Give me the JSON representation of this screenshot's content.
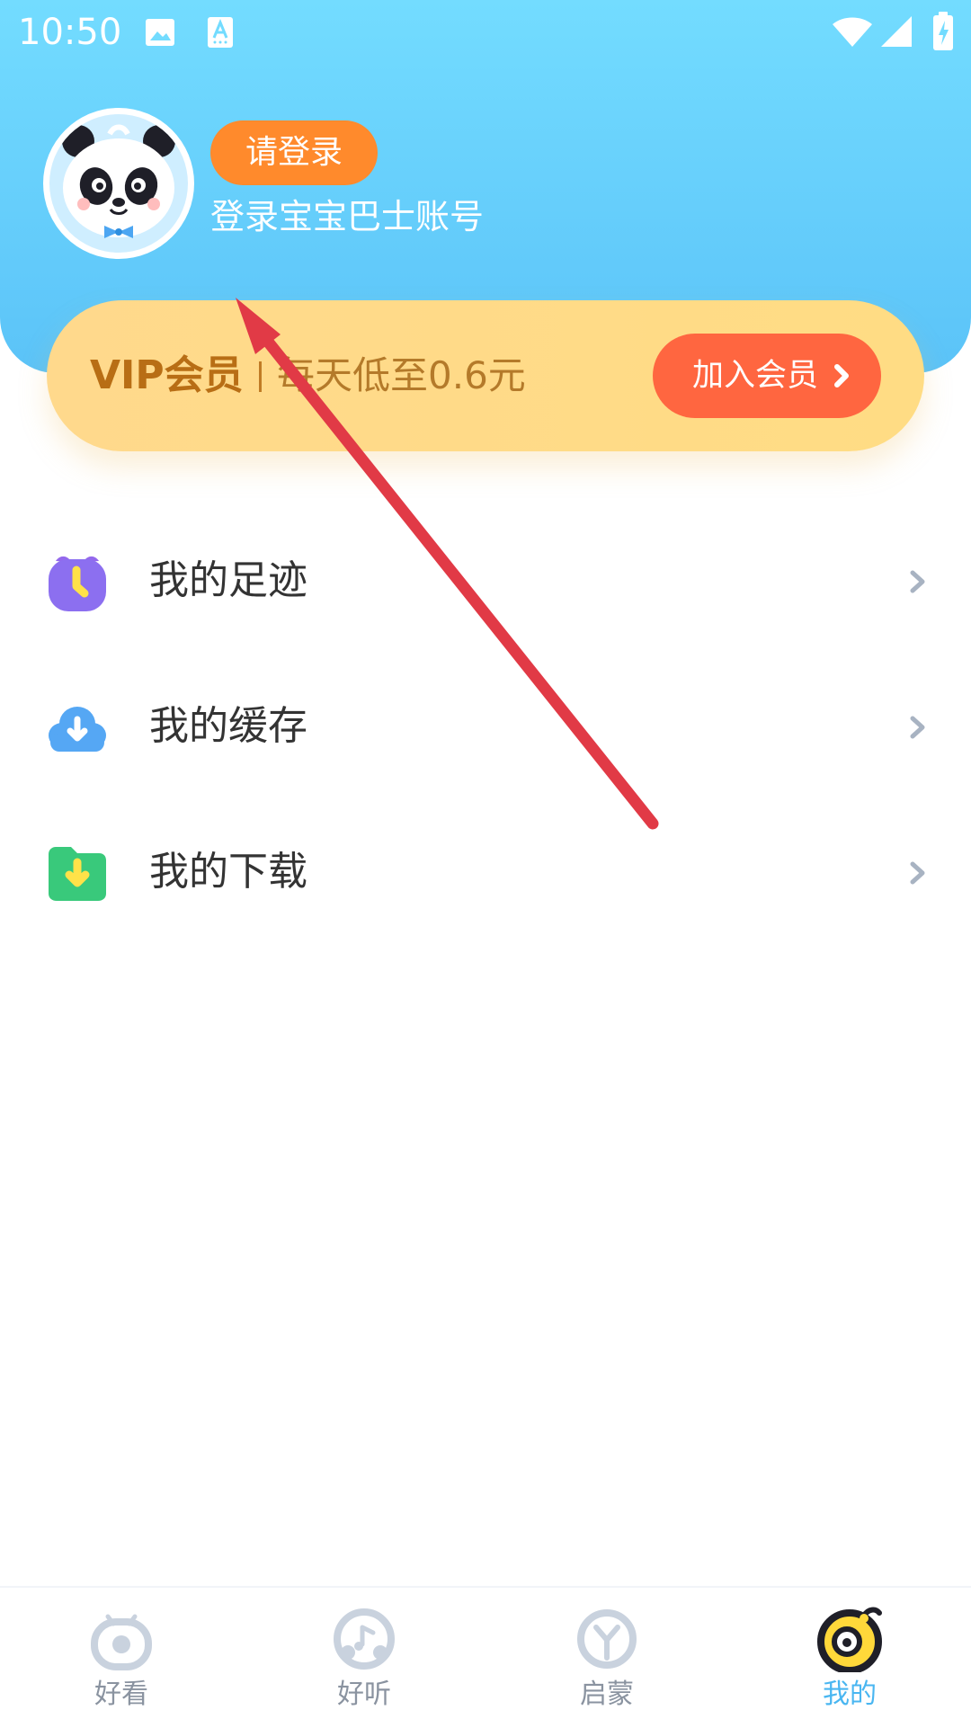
{
  "colors": {
    "header_gradient_start": "#73dcff",
    "header_gradient_end": "#5bc3f8",
    "login_button": "#ff8a2c",
    "vip_card": "#ffdc84",
    "vip_title": "#b86e15",
    "join_button": "#ff6640",
    "nav_active": "#49b6f1",
    "nav_inactive": "#8a93a0",
    "annotation_arrow": "#e13a46"
  },
  "status_bar": {
    "time": "10:50",
    "icons": [
      "image-icon",
      "a-icon",
      "wifi-icon",
      "signal-icon",
      "battery-icon"
    ]
  },
  "profile": {
    "avatar_icon": "panda-avatar",
    "login_button_label": "请登录",
    "subtitle": "登录宝宝巴士账号"
  },
  "vip": {
    "title": "VIP会员",
    "price_text": "每天低至0.6元",
    "join_label": "加入会员",
    "join_icon": "chevron-right-icon"
  },
  "menu": [
    {
      "label": "我的足迹",
      "icon": "clock-icon"
    },
    {
      "label": "我的缓存",
      "icon": "cloud-download-icon"
    },
    {
      "label": "我的下载",
      "icon": "folder-download-icon"
    }
  ],
  "bottom_nav": [
    {
      "label": "好看",
      "icon": "play-icon",
      "active": false
    },
    {
      "label": "好听",
      "icon": "music-icon",
      "active": false
    },
    {
      "label": "启蒙",
      "icon": "learn-icon",
      "active": false
    },
    {
      "label": "我的",
      "icon": "profile-face-icon",
      "active": true
    }
  ],
  "annotation": {
    "type": "arrow",
    "color": "#e13a46"
  }
}
